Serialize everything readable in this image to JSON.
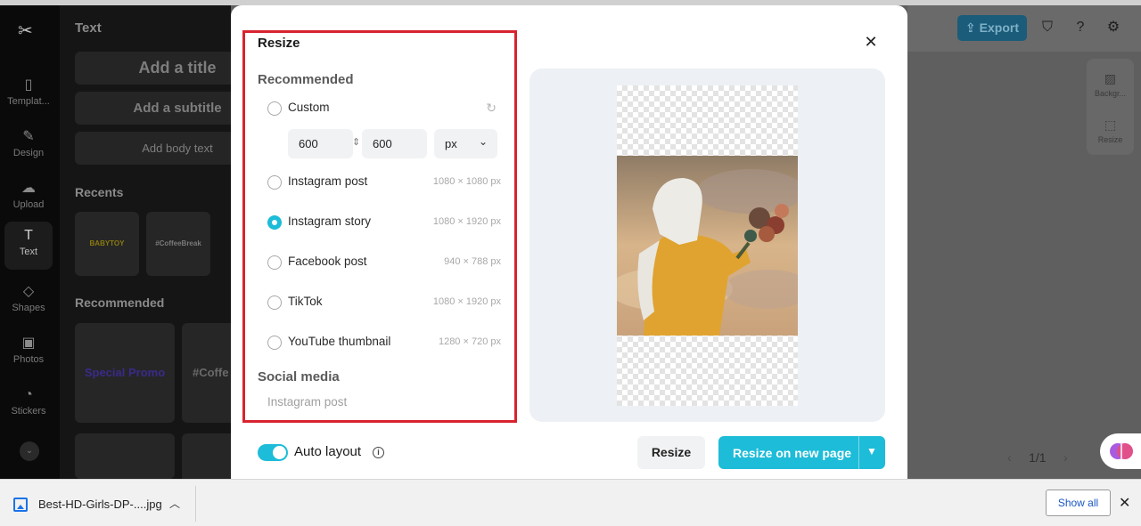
{
  "editor": {
    "rail": [
      {
        "label": "Templat...",
        "icon": "template-icon"
      },
      {
        "label": "Design",
        "icon": "design-icon"
      },
      {
        "label": "Upload",
        "icon": "upload-icon"
      },
      {
        "label": "Text",
        "icon": "text-icon"
      },
      {
        "label": "Shapes",
        "icon": "shapes-icon"
      },
      {
        "label": "Photos",
        "icon": "photos-icon"
      },
      {
        "label": "Stickers",
        "icon": "stickers-icon"
      }
    ],
    "panel": {
      "title": "Text",
      "add_title": "Add a title",
      "add_subtitle": "Add a subtitle",
      "add_body": "Add body text",
      "recents_heading": "Recents",
      "recent_thumbs": [
        "BABYTOY",
        "#CoffeeBreak"
      ],
      "recommended_heading": "Recommended",
      "recommended_thumbs": [
        "Special Promo",
        "#Coffe"
      ]
    },
    "topbar": {
      "export_label": "Export"
    },
    "side_tools": [
      {
        "label": "Backgr...",
        "icon": "background-icon"
      },
      {
        "label": "Resize",
        "icon": "resize-icon"
      }
    ],
    "pager": "1/1"
  },
  "modal": {
    "title": "Resize",
    "recommended_heading": "Recommended",
    "custom": {
      "label": "Custom",
      "width": "600",
      "height": "600",
      "unit": "px"
    },
    "options": [
      {
        "label": "Instagram post",
        "dims": "1080 × 1080 px",
        "selected": false
      },
      {
        "label": "Instagram story",
        "dims": "1080 × 1920 px",
        "selected": true
      },
      {
        "label": "Facebook post",
        "dims": "940 × 788 px",
        "selected": false
      },
      {
        "label": "TikTok",
        "dims": "1080 × 1920 px",
        "selected": false
      },
      {
        "label": "YouTube thumbnail",
        "dims": "1280 × 720 px",
        "selected": false
      }
    ],
    "social_heading": "Social media",
    "social_first": "Instagram post",
    "auto_layout_label": "Auto layout",
    "auto_layout_on": true,
    "resize_label": "Resize",
    "resize_new_label": "Resize on new page",
    "colors": {
      "accent": "#1dbcd8",
      "highlight": "#d8232f"
    }
  },
  "downloads": {
    "file_name": "Best-HD-Girls-DP-....jpg",
    "show_all": "Show all"
  }
}
